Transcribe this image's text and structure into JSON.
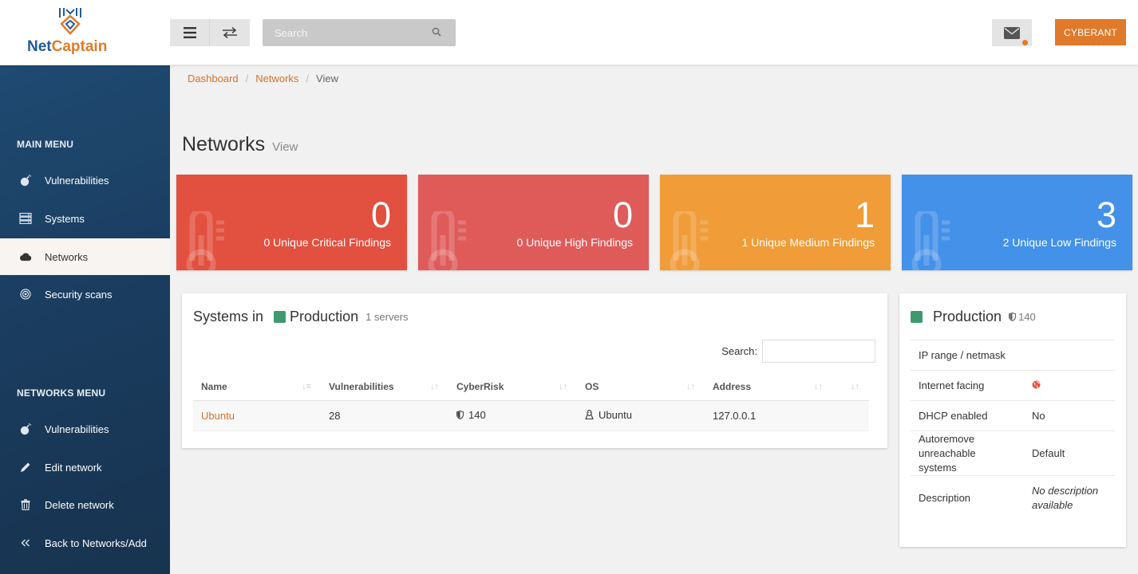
{
  "header": {
    "brand_prefix": "Net",
    "brand_suffix": "Captain",
    "search_placeholder": "Search",
    "user_button": "CYBERANT"
  },
  "sidebar": {
    "main_title": "MAIN MENU",
    "main_items": [
      {
        "label": "Vulnerabilities",
        "icon": "bomb-icon"
      },
      {
        "label": "Systems",
        "icon": "server-icon"
      },
      {
        "label": "Networks",
        "icon": "cloud-icon",
        "active": true
      },
      {
        "label": "Security scans",
        "icon": "target-icon"
      }
    ],
    "networks_title": "NETWORKS MENU",
    "networks_items": [
      {
        "label": "Vulnerabilities",
        "icon": "bomb-icon"
      },
      {
        "label": "Edit network",
        "icon": "pencil-icon"
      },
      {
        "label": "Delete network",
        "icon": "trash-icon"
      },
      {
        "label": "Back to Networks/Add",
        "icon": "double-chevron-left-icon"
      }
    ]
  },
  "breadcrumb": [
    "Dashboard",
    "Networks",
    "View"
  ],
  "page": {
    "title": "Networks",
    "subtitle": "View"
  },
  "stats": [
    {
      "value": "0",
      "label": "0 Unique Critical Findings",
      "color": "#e2503f"
    },
    {
      "value": "0",
      "label": "0 Unique High Findings",
      "color": "#df5b5a"
    },
    {
      "value": "1",
      "label": "1 Unique Medium Findings",
      "color": "#f09c38"
    },
    {
      "value": "3",
      "label": "2 Unique Low Findings",
      "color": "#4491e9"
    }
  ],
  "systems": {
    "title_prefix": "Systems in",
    "network_name": "Production",
    "network_color": "#3e9a6e",
    "count": "1 servers",
    "search_label": "Search:",
    "columns": [
      "Name",
      "Vulnerabilities",
      "CyberRisk",
      "OS",
      "Address",
      ""
    ],
    "rows": [
      {
        "name": "Ubuntu",
        "vulnerabilities": "28",
        "cyberrisk": "140",
        "os": "Ubuntu",
        "address": "127.0.0.1"
      }
    ]
  },
  "details": {
    "network_name": "Production",
    "cyberrisk": "140",
    "rows": [
      {
        "key": "IP range / netmask",
        "value": ""
      },
      {
        "key": "Internet facing",
        "value": "",
        "icon": "globe-icon"
      },
      {
        "key": "DHCP enabled",
        "value": "No"
      },
      {
        "key": "Autoremove unreachable systems",
        "value": "Default"
      },
      {
        "key": "Description",
        "value": "No description available",
        "italic": true
      }
    ]
  }
}
